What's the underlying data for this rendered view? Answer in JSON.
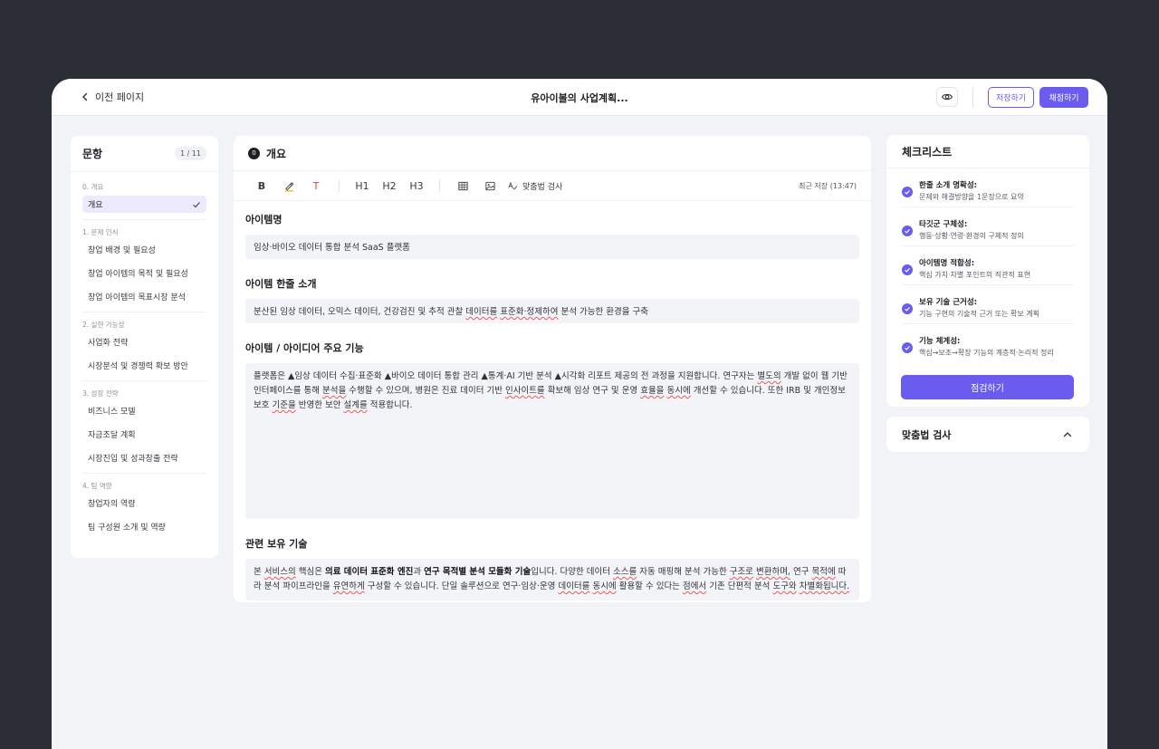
{
  "header": {
    "back_label": "이전 페이지",
    "title": "유아이볼의 사업계획...",
    "save_label": "저장하기",
    "grade_label": "채점하기"
  },
  "nav": {
    "title": "문항",
    "count": "1 / 11",
    "sections": [
      {
        "label": "0. 개요",
        "items": [
          "개요"
        ]
      },
      {
        "label": "1. 문제 인식",
        "items": [
          "창업 배경 및 필요성",
          "창업 아이템의 목적 및 필요성",
          "창업 아이템의 목표시장 분석"
        ]
      },
      {
        "label": "2. 실현 가능성",
        "items": [
          "사업화 전략",
          "시장분석 및 경쟁력 확보 방안"
        ]
      },
      {
        "label": "3. 성장 전략",
        "items": [
          "비즈니스 모델",
          "자금조달 계획",
          "시장진입 및 성과창출 전략"
        ]
      },
      {
        "label": "4. 팀 역량",
        "items": [
          "창업자의 역량",
          "팀 구성원 소개 및 역량"
        ]
      }
    ]
  },
  "editor": {
    "num": "0",
    "title": "개요",
    "toolbar": {
      "bold": "B",
      "text_color": "T",
      "h1": "H1",
      "h2": "H2",
      "h3": "H3",
      "spellcheck": "맞춤법 검사"
    },
    "saved": "최근 저장 (13:47)",
    "fields": {
      "name_label": "아이템명",
      "name_value": "임상·바이오 데이터 통합 분석 SaaS 플랫폼",
      "intro_label": "아이템 한줄 소개",
      "intro_a": "분산된 임상 데이터, 오믹스 데이터, 건강검진 및 추적 관찰 ",
      "intro_b": "데이터를",
      "intro_c": " ",
      "intro_d": "표준화·정제하여",
      "intro_e": " 분석 가능한 환경을 구축",
      "features_label": "아이템 / 아이디어 주요 기능",
      "f1": "플랫폼은 ▲임상 데이터 수집·표준화 ▲바이오 데이터 통합 관리 ▲통계·AI 기반 분석 ▲시각화 리포트 제공의 전 과정을 지원합니다. 연구자는 ",
      "f2": "별도의",
      "f3": " 개발 없이 웹 기반 인터페이스를 통해 ",
      "f4": "분석을",
      "f5": " 수행할 수 있으며, 병원은 진료 데이터 기반 ",
      "f6": "인사이트를",
      "f7": " 확보해 임상 연구 및 운영 ",
      "f8": "효율을",
      "f9": " ",
      "f10": "동시에",
      "f11": " 개선할 수 있습니다. 또한 IRB 및 개인정보 보호 ",
      "f12": "기준을",
      "f13": " 반영한 보안 ",
      "f14": "설계를",
      "f15": " 적용합니다.",
      "tech_label": "관련 보유 기술",
      "t1": "본 ",
      "t2": "서비스의",
      "t3": " 핵심은 ",
      "t4": "의료 데이터 표준화 엔진",
      "t5": "과 ",
      "t6": "연구 목적별 분석 모듈화 기술",
      "t7": "입니다. 다양한 데이터 ",
      "t8": "소스를",
      "t9": " 자동 매핑해 분석 가능한 ",
      "t10": "구조로",
      "t11": " ",
      "t12": "변환하며,",
      "t13": " 연구 ",
      "t14": "목적에",
      "t15": " 따라 분석 파이프라인을 ",
      "t16": "유연하게",
      "t17": " 구성할 수 있습니다. 단일 솔루션으로 연구·임상·운영 ",
      "t18": "데이터를",
      "t19": " ",
      "t20": "동시에",
      "t21": " 활용할 수 있다는 ",
      "t22": "점에서",
      "t23": " 기존 단편적 분석 ",
      "t24": "도구와",
      "t25": " ",
      "t26": "차별화됩니다."
    }
  },
  "checklist": {
    "title": "체크리스트",
    "items": [
      {
        "title": "한줄 소개 명확성:",
        "desc": "문제와 해결방향을 1문장으로 요약"
      },
      {
        "title": "타깃군 구체성:",
        "desc": "행동·상황·연령·환경의 구체적 정의"
      },
      {
        "title": "아이템명 적합성:",
        "desc": "핵심 가치·차별 포인트의 직관적 표현"
      },
      {
        "title": "보유 기술 근거성:",
        "desc": "기능 구현의 기술적 근거 또는 확보 계획"
      },
      {
        "title": "기능 체계성:",
        "desc": "핵심→보조→확장 기능의 계층적·논리적 정리"
      }
    ],
    "button_label": "점검하기"
  },
  "spellcheck": {
    "title": "맞춤법 검사"
  },
  "colors": {
    "accent": "#6b5cf0",
    "background": "#2b2e36",
    "panel": "#f2f3f6"
  }
}
